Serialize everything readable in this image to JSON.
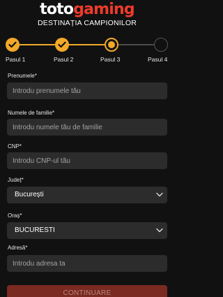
{
  "header": {
    "logo_part1": "toto",
    "logo_part2": "gaming",
    "tagline": "DESTINAȚIA CAMPIONILOR"
  },
  "stepper": {
    "steps": [
      {
        "label": "Pasul 1",
        "state": "done"
      },
      {
        "label": "Pasul 2",
        "state": "done"
      },
      {
        "label": "Pasul 3",
        "state": "current"
      },
      {
        "label": "Pasul 4",
        "state": "todo"
      }
    ]
  },
  "form": {
    "prenume": {
      "label": "Prenumele*",
      "placeholder": "Introdu prenumele tău",
      "value": ""
    },
    "nume": {
      "label": "Numele de familie*",
      "placeholder": "Introdu numele tău de familie",
      "value": ""
    },
    "cnp": {
      "label": "CNP*",
      "placeholder": "Introdu CNP-ul tău",
      "value": ""
    },
    "judet": {
      "label": "Județ*",
      "value": "București"
    },
    "oras": {
      "label": "Oraș*",
      "value": "BUCURESTI"
    },
    "adresa": {
      "label": "Adresă*",
      "placeholder": "Introdu adresa ta",
      "value": ""
    }
  },
  "submit_label": "CONTINUARE",
  "colors": {
    "accent": "#f2a92a",
    "brand_red": "#ee3b2c",
    "background": "#111111",
    "input_bg": "#2c2c2c",
    "button_bg": "#7a2a20"
  },
  "icons": [
    "check-icon",
    "chevron-down-icon"
  ]
}
